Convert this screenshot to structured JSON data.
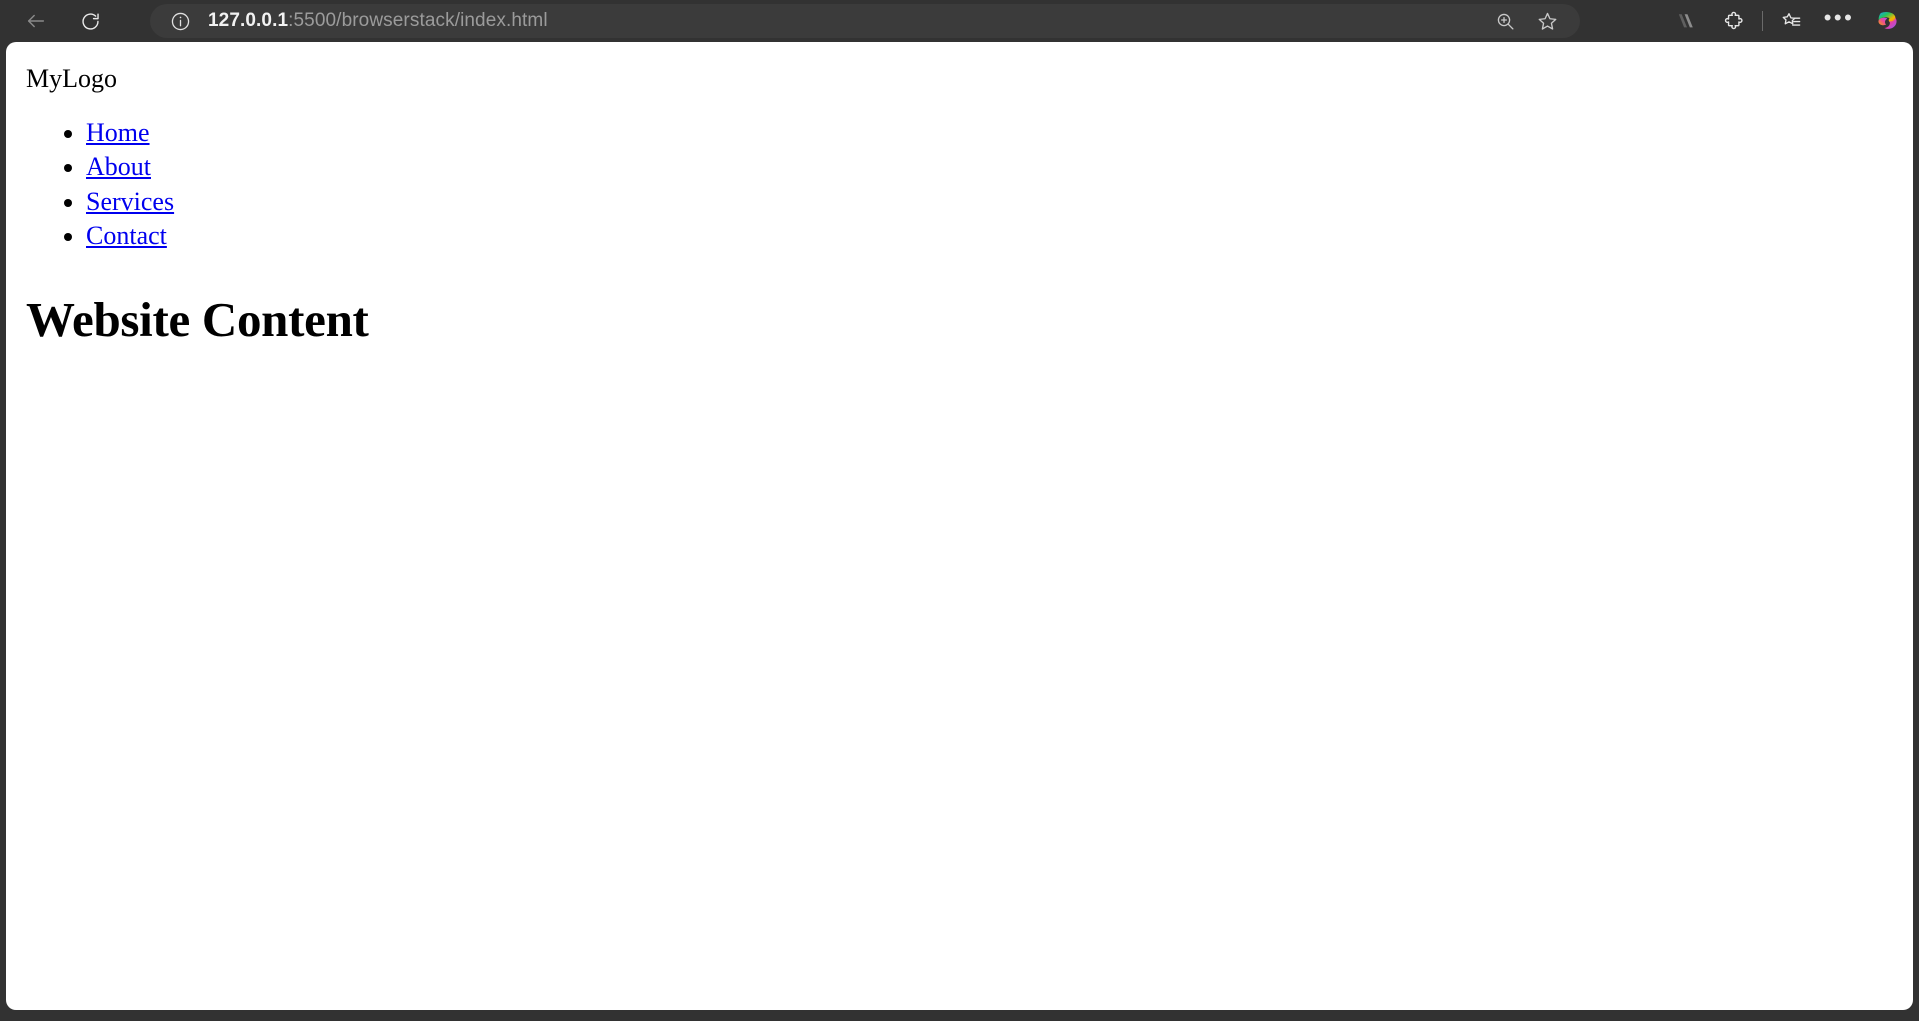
{
  "browser": {
    "nav": {
      "back_label": "Back",
      "back_icon": "arrow-left-icon",
      "reload_label": "Refresh",
      "reload_icon": "reload-icon"
    },
    "address_bar": {
      "site_info_icon": "info-circle-icon",
      "url_host": "127.0.0.1",
      "url_path": ":5500/browserstack/index.html",
      "full_url": "127.0.0.1:5500/browserstack/index.html",
      "zoom_icon": "zoom-in-magnifier-icon",
      "favorite_icon": "star-outline-icon"
    },
    "toolbar_icons": [
      {
        "name": "extension-mountain-icon",
        "label": "Extension"
      },
      {
        "name": "puzzle-piece-icon",
        "label": "Extensions"
      },
      {
        "name": "collections-star-icon",
        "label": "Collections"
      },
      {
        "name": "ellipsis-icon",
        "label": "Settings and more",
        "glyph": "•••"
      },
      {
        "name": "copilot-icon",
        "label": "Copilot"
      }
    ],
    "colors": {
      "chrome_bg": "#323232",
      "address_bg": "#3b3b3b",
      "url_host_color": "#f2f2f2",
      "url_path_color": "#9b9b9b",
      "page_bg": "#ffffff",
      "link_color": "#0000ee"
    }
  },
  "page": {
    "logo": "MyLogo",
    "nav_items": [
      {
        "label": "Home"
      },
      {
        "label": "About"
      },
      {
        "label": "Services"
      },
      {
        "label": "Contact"
      }
    ],
    "heading": "Website Content"
  }
}
